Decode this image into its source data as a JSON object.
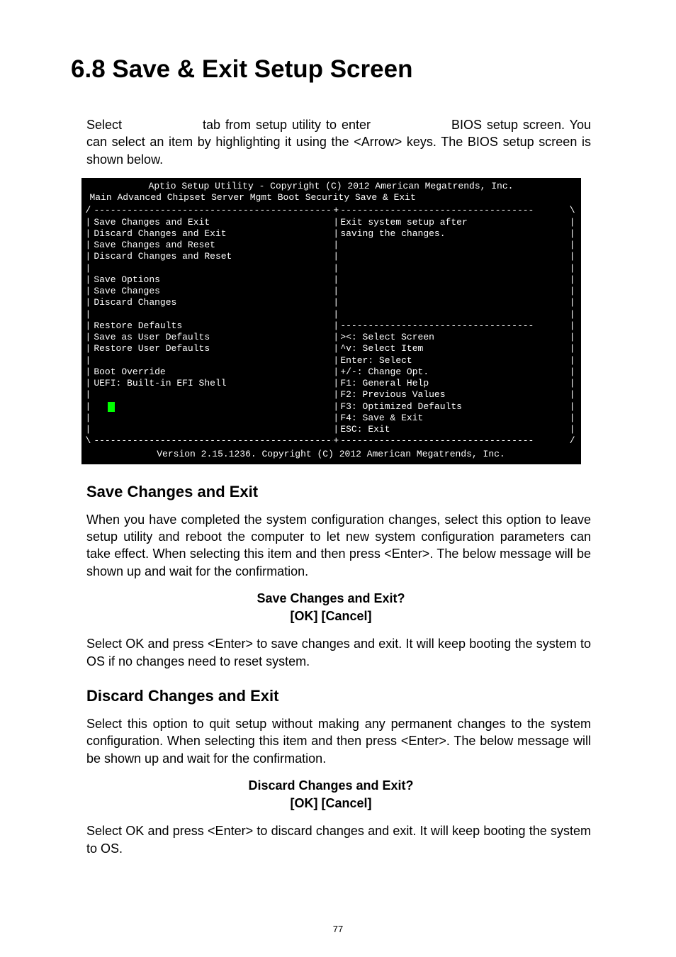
{
  "pageNumber": "77",
  "heading": "6.8  Save & Exit Setup Screen",
  "intro": {
    "p1_a": "Select ",
    "p1_b": "tab from setup utility to enter ",
    "p1_c": "BIOS setup screen. You can select an item by highlighting it using the <Arrow> keys. The BIOS setup screen is shown below."
  },
  "bios": {
    "title": "Aptio Setup Utility - Copyright (C) 2012 American Megatrends, Inc.",
    "menubar": " Main  Advanced  Chipset  Server Mgmt  Boot  Security  Save & Exit",
    "leftItems": {
      "i0": "Save Changes and Exit",
      "i1": "Discard Changes and Exit",
      "i2": "Save Changes and Reset",
      "i3": "Discard Changes and Reset",
      "blank1": "",
      "i4": "Save Options",
      "i5": "Save Changes",
      "i6": "Discard Changes",
      "blank2": "",
      "i7": "Restore Defaults",
      "i8": "Save as User Defaults",
      "i9": "Restore User Defaults",
      "blank3": "",
      "i10": "Boot Override",
      "i11": "UEFI: Built-in EFI Shell"
    },
    "help": {
      "h1": "Exit system setup after",
      "h2": "saving the changes."
    },
    "keys": {
      "k1": "><: Select Screen",
      "k2": "^v: Select Item",
      "k3": "Enter: Select",
      "k4": "+/-: Change Opt.",
      "k5": "F1: General Help",
      "k6": "F2: Previous Values",
      "k7": "F3: Optimized Defaults",
      "k8": "F4: Save & Exit",
      "k9": "ESC: Exit"
    },
    "footer": "Version 2.15.1236. Copyright (C) 2012 American Megatrends, Inc."
  },
  "sec1": {
    "title": "Save Changes and Exit",
    "p1": "When you have completed the system configuration changes, select this option to leave setup utility and reboot the computer to let new system configuration parameters can take effect. When selecting this item and then press <Enter>. The below message will be shown up and wait for the confirmation.",
    "promptLine1": "Save Changes and Exit?",
    "promptLine2": "[OK] [Cancel]",
    "p2": "Select OK and press <Enter> to save changes and exit. It will keep booting the system to OS if no changes need to reset system."
  },
  "sec2": {
    "title": "Discard Changes and Exit",
    "p1": "Select this option to quit setup without making any permanent changes to the system configuration. When selecting this item and then press <Enter>. The below message will be shown up and wait for the confirmation.",
    "promptLine1": "Discard Changes and Exit?",
    "promptLine2": "[OK] [Cancel]",
    "p2": "Select OK and press <Enter> to discard changes and exit. It will keep booting the system to OS."
  }
}
